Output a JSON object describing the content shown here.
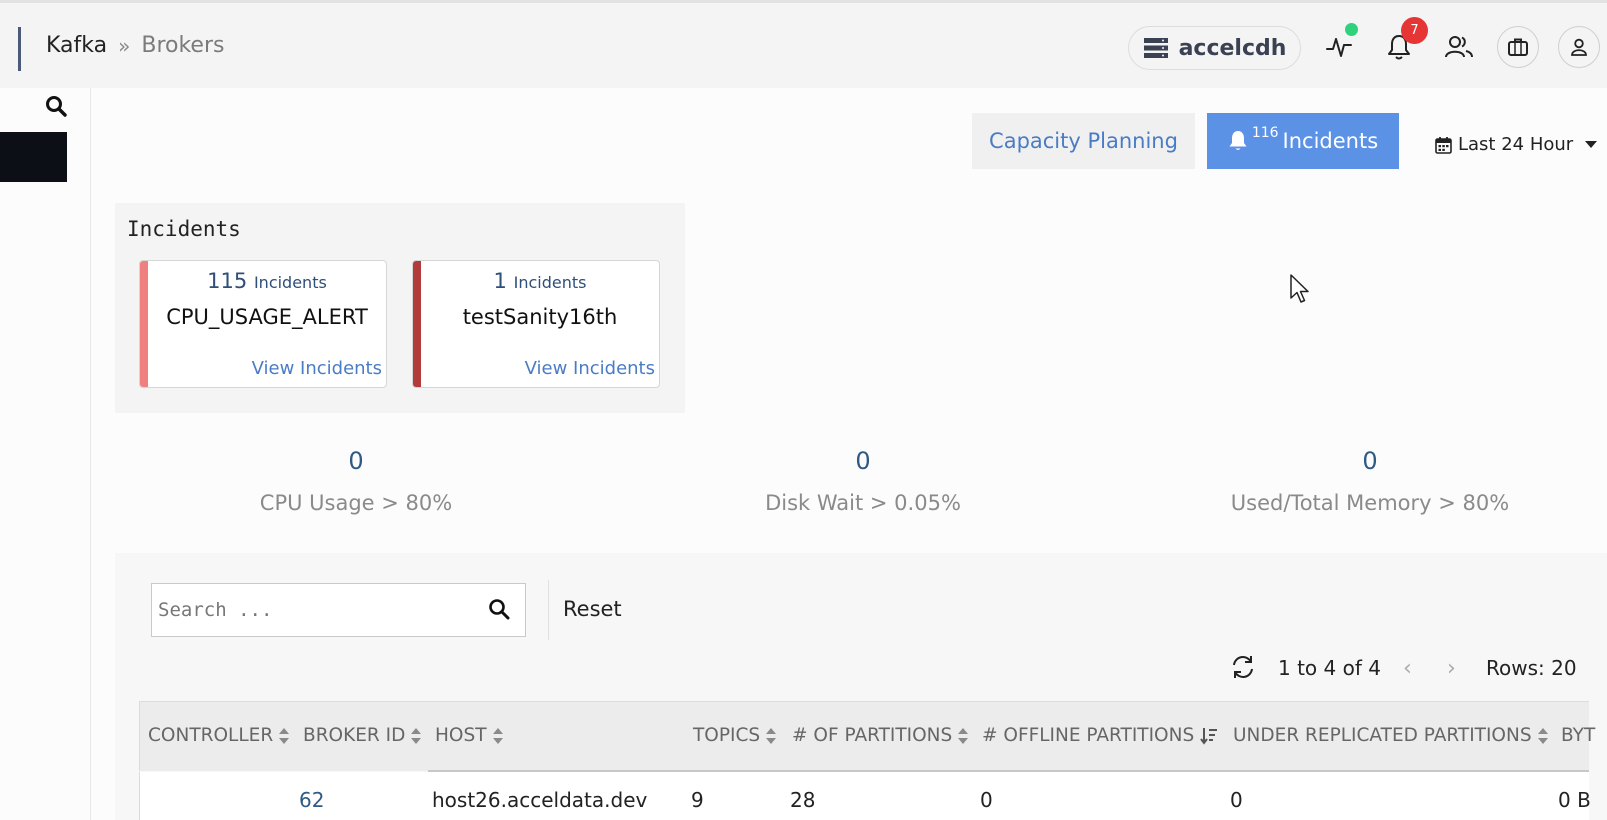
{
  "header": {
    "breadcrumb_root": "Kafka",
    "breadcrumb_sep": "»",
    "breadcrumb_current": "Brokers",
    "cluster_name": "accelcdh",
    "notification_count": "7",
    "icons": [
      "cluster-server-icon",
      "activity-pulse-icon",
      "bell-icon",
      "users-icon",
      "briefcase-icon",
      "user-icon"
    ],
    "status_color": "#2fd17d",
    "badge_color": "#e53535"
  },
  "toolbar": {
    "capacity_label": "Capacity Planning",
    "incidents_count": "116",
    "incidents_label": "Incidents",
    "timerange_label": "Last 24 Hour",
    "accent_color": "#5b92e5"
  },
  "incidents": {
    "title": "Incidents",
    "count_unit": "Incidents",
    "link_label": "View Incidents",
    "cards": [
      {
        "count": "115",
        "name": "CPU_USAGE_ALERT",
        "stripe_color": "#f08080"
      },
      {
        "count": "1",
        "name": "testSanity16th",
        "stripe_color": "#b23b3b"
      }
    ]
  },
  "metrics": [
    {
      "value": "0",
      "label": "CPU Usage > 80%"
    },
    {
      "value": "0",
      "label": "Disk Wait > 0.05%"
    },
    {
      "value": "0",
      "label": "Used/Total Memory > 80%"
    }
  ],
  "table": {
    "search_placeholder": "Search ...",
    "reset_label": "Reset",
    "pager_text": "1 to 4 of 4",
    "prev_symbol": "‹",
    "next_symbol": "›",
    "rows_label": "Rows: 20",
    "columns": [
      "CONTROLLER",
      "BROKER ID",
      "HOST",
      "TOPICS",
      "# OF PARTITIONS",
      "# OFFLINE PARTITIONS",
      "UNDER REPLICATED PARTITIONS",
      "BYT"
    ],
    "rows": [
      {
        "controller": "",
        "broker_id": "62",
        "host": "host26.acceldata.dev",
        "topics": "9",
        "partitions": "28",
        "offline": "0",
        "under_replicated": "0",
        "bytes": "0 B"
      }
    ]
  }
}
